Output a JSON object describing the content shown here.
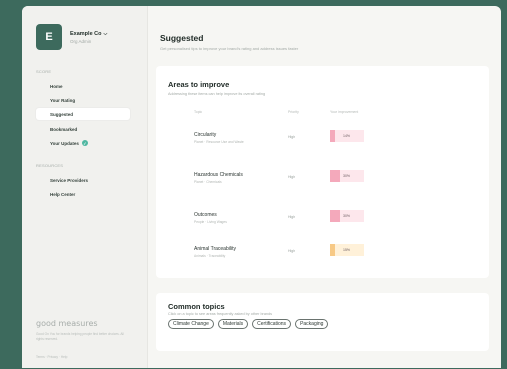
{
  "org": {
    "avatar_letter": "E",
    "name": "Example Co",
    "sub": "Org Admin"
  },
  "sidebar": {
    "section_1": "SCORE",
    "items": [
      {
        "label": "Home"
      },
      {
        "label": "Your Rating"
      },
      {
        "label": "Suggested",
        "active": true
      },
      {
        "label": "Bookmarked"
      },
      {
        "label": "Your Updates",
        "badge": "check-icon"
      }
    ],
    "section_2": "RESOURCES",
    "items_2": [
      {
        "label": "Service Providers"
      },
      {
        "label": "Help Center"
      }
    ],
    "brand": "good measures",
    "brand_desc": "Good On You for brands helping people find better choices. All rights reserved.",
    "brand_links": "Terms · Privacy · Help"
  },
  "main": {
    "title": "Suggested",
    "subtitle": "Get personalised tips to improve your brand's rating and address issues faster",
    "areas": {
      "title": "Areas to improve",
      "subtitle": "Addressing these items can help improve its overall rating",
      "headers": {
        "topic": "Topic",
        "level": "Priority",
        "bar": "Your improvement"
      },
      "rows": [
        {
          "name": "Circularity",
          "desc": "Planet · Resource Use and Waste",
          "level": "High",
          "value_label": "14%",
          "value": 0.14,
          "tone": "pink"
        },
        {
          "name": "Hazardous Chemicals",
          "desc": "Planet · Chemicals",
          "level": "High",
          "value_label": "30%",
          "value": 0.3,
          "tone": "pink"
        },
        {
          "name": "Outcomes",
          "desc": "People · Living Wages",
          "level": "High",
          "value_label": "30%",
          "value": 0.3,
          "tone": "pink"
        },
        {
          "name": "Animal Traceability",
          "desc": "Animals · Traceability",
          "level": "High",
          "value_label": "15%",
          "value": 0.15,
          "tone": "amber"
        }
      ]
    },
    "topics": {
      "title": "Common topics",
      "subtitle": "Click on a topic to see areas frequently asked by other brands",
      "chips": [
        "Climate Change",
        "Materials",
        "Certifications",
        "Packaging"
      ]
    }
  },
  "colors": {
    "accent": "#3d6a5d",
    "pink": "#f4a9bb",
    "amber": "#f7c986"
  }
}
